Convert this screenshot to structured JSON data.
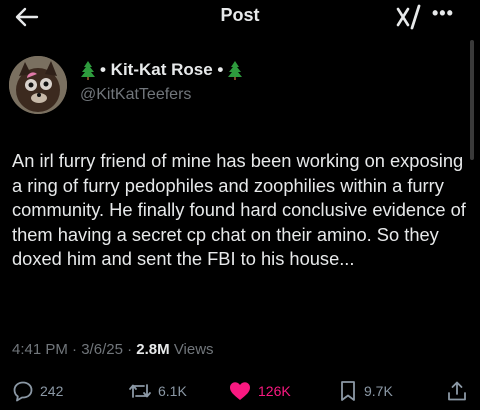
{
  "header": {
    "title": "Post",
    "back_icon": "arrow-left-icon",
    "brand_icon": "xai-grok-icon",
    "more_label": "•••"
  },
  "author": {
    "name": "• Kit-Kat Rose •",
    "handle": "@KitKatTeefers",
    "decoration_icon": "christmas-tree-icon"
  },
  "post": {
    "text": "An irl furry friend of mine has been working on exposing a ring of furry pedophiles and zoophilies within a furry community. He finally found hard conclusive evidence of them having a secret cp chat on their amino. So they doxed him and sent the FBI to his house...",
    "time": "4:41 PM",
    "date": "3/6/25",
    "views_count": "2.8M",
    "views_label": "Views",
    "separator": "·"
  },
  "actions": {
    "replies": "242",
    "reposts": "6.1K",
    "likes": "126K",
    "bookmarks": "9.7K",
    "like_color": "#f91880"
  }
}
